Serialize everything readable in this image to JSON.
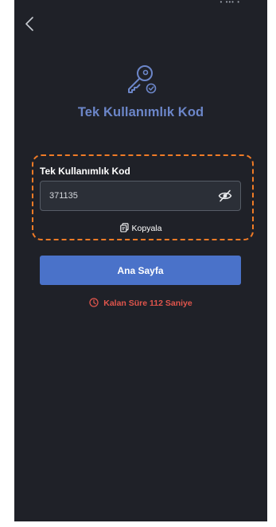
{
  "header": {
    "status_indicators": "• ••• •"
  },
  "icons": {
    "back": "chevron-left-icon",
    "hero": "key-check-icon",
    "visibility": "eye-off-icon",
    "copy": "copy-icon",
    "timer": "clock-icon"
  },
  "page": {
    "title": "Tek Kullanımlık Kod"
  },
  "otp": {
    "label": "Tek Kullanımlık Kod",
    "value": "371135",
    "copy_label": "Kopyala"
  },
  "actions": {
    "home_label": "Ana Sayfa"
  },
  "timer": {
    "text": "Kalan Süre 112 Saniye"
  },
  "colors": {
    "background": "#1f2128",
    "accent": "#4a72c9",
    "title": "#6c86c9",
    "highlight_border": "#f07b26",
    "warning": "#e0554c"
  }
}
